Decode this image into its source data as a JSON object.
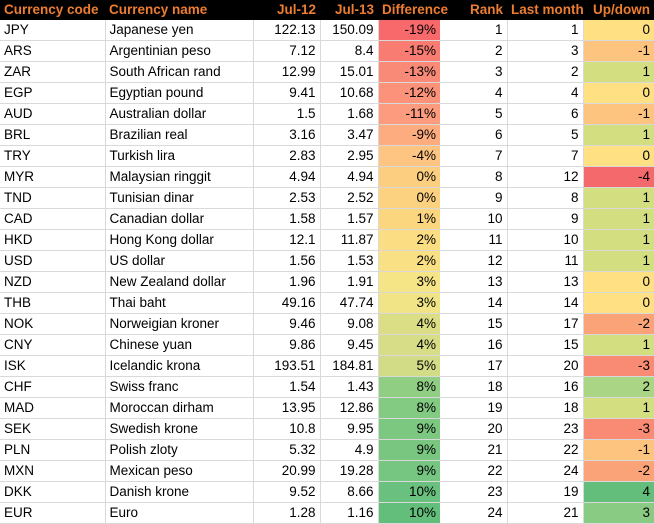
{
  "table": {
    "columns": [
      {
        "key": "code",
        "label": "Currency code",
        "align": "left"
      },
      {
        "key": "name",
        "label": "Currency name",
        "align": "left"
      },
      {
        "key": "jul12",
        "label": "Jul-12",
        "align": "right"
      },
      {
        "key": "jul13",
        "label": "Jul-13",
        "align": "right"
      },
      {
        "key": "difference",
        "label": "Difference",
        "align": "right"
      },
      {
        "key": "rank",
        "label": "Rank",
        "align": "right"
      },
      {
        "key": "last_month",
        "label": "Last month",
        "align": "right"
      },
      {
        "key": "updown",
        "label": "Up/down",
        "align": "right"
      }
    ],
    "header_bg": "#000000",
    "header_color": "#ED7D31",
    "gridline_color": "#D9D9D9",
    "rows": [
      {
        "code": "JPY",
        "name": "Japanese yen",
        "jul12": "122.13",
        "jul13": "150.09",
        "difference": "-19%",
        "rank": "1",
        "last_month": "1",
        "updown": "0",
        "diff_bg": "#F8696B",
        "updown_bg": "#FFE183"
      },
      {
        "code": "ARS",
        "name": "Argentinian peso",
        "jul12": "7.12",
        "jul13": "8.4",
        "difference": "-15%",
        "rank": "2",
        "last_month": "3",
        "updown": "-1",
        "diff_bg": "#F97C73",
        "updown_bg": "#FCC47E"
      },
      {
        "code": "ZAR",
        "name": "South African rand",
        "jul12": "12.99",
        "jul13": "15.01",
        "difference": "-13%",
        "rank": "3",
        "last_month": "2",
        "updown": "1",
        "diff_bg": "#FA8A78",
        "updown_bg": "#D3DE81"
      },
      {
        "code": "EGP",
        "name": "Egyptian pound",
        "jul12": "9.41",
        "jul13": "10.68",
        "difference": "-12%",
        "rank": "4",
        "last_month": "4",
        "updown": "0",
        "diff_bg": "#FB9279",
        "updown_bg": "#FFE183"
      },
      {
        "code": "AUD",
        "name": "Australian dollar",
        "jul12": "1.5",
        "jul13": "1.68",
        "difference": "-11%",
        "rank": "5",
        "last_month": "6",
        "updown": "-1",
        "diff_bg": "#FC9B7D",
        "updown_bg": "#FCC47E"
      },
      {
        "code": "BRL",
        "name": "Brazilian real",
        "jul12": "3.16",
        "jul13": "3.47",
        "difference": "-9%",
        "rank": "6",
        "last_month": "5",
        "updown": "1",
        "diff_bg": "#FDAC80",
        "updown_bg": "#D3DE81"
      },
      {
        "code": "TRY",
        "name": "Turkish lira",
        "jul12": "2.83",
        "jul13": "2.95",
        "difference": "-4%",
        "rank": "7",
        "last_month": "7",
        "updown": "0",
        "diff_bg": "#FEC582",
        "updown_bg": "#FFE183"
      },
      {
        "code": "MYR",
        "name": "Malaysian ringgit",
        "jul12": "4.94",
        "jul13": "4.94",
        "difference": "0%",
        "rank": "8",
        "last_month": "12",
        "updown": "-4",
        "diff_bg": "#FCCE7F",
        "updown_bg": "#F4696B"
      },
      {
        "code": "TND",
        "name": "Tunisian dinar",
        "jul12": "2.53",
        "jul13": "2.52",
        "difference": "0%",
        "rank": "9",
        "last_month": "8",
        "updown": "1",
        "diff_bg": "#FCD180",
        "updown_bg": "#D3DE81"
      },
      {
        "code": "CAD",
        "name": "Canadian dollar",
        "jul12": "1.58",
        "jul13": "1.57",
        "difference": "1%",
        "rank": "10",
        "last_month": "9",
        "updown": "1",
        "diff_bg": "#FCD57F",
        "updown_bg": "#D3DE81"
      },
      {
        "code": "HKD",
        "name": "Hong Kong dollar",
        "jul12": "12.1",
        "jul13": "11.87",
        "difference": "2%",
        "rank": "11",
        "last_month": "10",
        "updown": "1",
        "diff_bg": "#FBDD83",
        "updown_bg": "#D3DE81"
      },
      {
        "code": "USD",
        "name": "US dollar",
        "jul12": "1.56",
        "jul13": "1.53",
        "difference": "2%",
        "rank": "12",
        "last_month": "11",
        "updown": "1",
        "diff_bg": "#FAE084",
        "updown_bg": "#D3DE81"
      },
      {
        "code": "NZD",
        "name": "New Zealand dollar",
        "jul12": "1.96",
        "jul13": "1.91",
        "difference": "3%",
        "rank": "13",
        "last_month": "13",
        "updown": "0",
        "diff_bg": "#F6E586",
        "updown_bg": "#FFE183"
      },
      {
        "code": "THB",
        "name": "Thai baht",
        "jul12": "49.16",
        "jul13": "47.74",
        "difference": "3%",
        "rank": "14",
        "last_month": "14",
        "updown": "0",
        "diff_bg": "#F0E487",
        "updown_bg": "#FFE183"
      },
      {
        "code": "NOK",
        "name": "Norweigian kroner",
        "jul12": "9.46",
        "jul13": "9.08",
        "difference": "4%",
        "rank": "15",
        "last_month": "17",
        "updown": "-2",
        "diff_bg": "#DCDE86",
        "updown_bg": "#FBA378"
      },
      {
        "code": "CNY",
        "name": "Chinese yuan",
        "jul12": "9.86",
        "jul13": "9.45",
        "difference": "4%",
        "rank": "16",
        "last_month": "15",
        "updown": "1",
        "diff_bg": "#D7DD86",
        "updown_bg": "#D3DE81"
      },
      {
        "code": "ISK",
        "name": "Icelandic krona",
        "jul12": "193.51",
        "jul13": "184.81",
        "difference": "5%",
        "rank": "17",
        "last_month": "20",
        "updown": "-3",
        "diff_bg": "#D2DC86",
        "updown_bg": "#F98B74"
      },
      {
        "code": "CHF",
        "name": "Swiss franc",
        "jul12": "1.54",
        "jul13": "1.43",
        "difference": "8%",
        "rank": "18",
        "last_month": "16",
        "updown": "2",
        "diff_bg": "#8FCE83",
        "updown_bg": "#A9D585"
      },
      {
        "code": "MAD",
        "name": "Moroccan dirham",
        "jul12": "13.95",
        "jul13": "12.86",
        "difference": "8%",
        "rank": "19",
        "last_month": "18",
        "updown": "1",
        "diff_bg": "#83CA82",
        "updown_bg": "#D3DE81"
      },
      {
        "code": "SEK",
        "name": "Swedish krone",
        "jul12": "10.8",
        "jul13": "9.95",
        "difference": "9%",
        "rank": "20",
        "last_month": "23",
        "updown": "-3",
        "diff_bg": "#7DC881",
        "updown_bg": "#F98B74"
      },
      {
        "code": "PLN",
        "name": "Polish zloty",
        "jul12": "5.32",
        "jul13": "4.9",
        "difference": "9%",
        "rank": "21",
        "last_month": "22",
        "updown": "-1",
        "diff_bg": "#79C681",
        "updown_bg": "#FCC47E"
      },
      {
        "code": "MXN",
        "name": "Mexican peso",
        "jul12": "20.99",
        "jul13": "19.28",
        "difference": "9%",
        "rank": "22",
        "last_month": "24",
        "updown": "-2",
        "diff_bg": "#76C581",
        "updown_bg": "#FBA378"
      },
      {
        "code": "DKK",
        "name": "Danish krone",
        "jul12": "9.52",
        "jul13": "8.66",
        "difference": "10%",
        "rank": "23",
        "last_month": "19",
        "updown": "4",
        "diff_bg": "#69C07F",
        "updown_bg": "#63BE7B"
      },
      {
        "code": "EUR",
        "name": "Euro",
        "jul12": "1.28",
        "jul13": "1.16",
        "difference": "10%",
        "rank": "24",
        "last_month": "21",
        "updown": "3",
        "diff_bg": "#63BE7B",
        "updown_bg": "#8ACB83"
      }
    ]
  }
}
